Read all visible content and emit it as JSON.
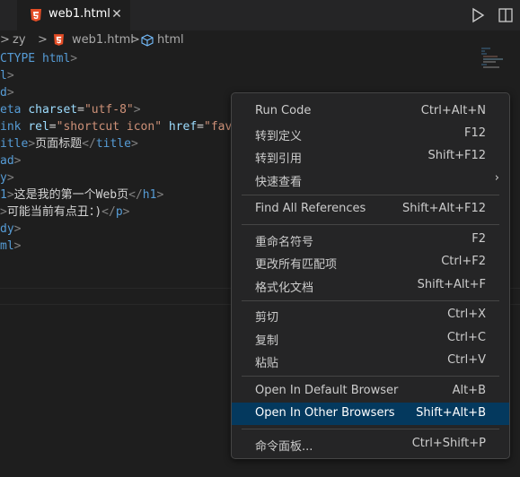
{
  "tab": {
    "label": "web1.html",
    "close": "✕"
  },
  "breadcrumb": {
    "chevron_start": ">",
    "folder": "zy",
    "sep": ">",
    "file": "web1.html",
    "sep2": ">",
    "symbol": "html"
  },
  "editor": {
    "l1": {
      "p1": "CTYPE ",
      "p2": "html",
      "p3": ">"
    },
    "l2": {
      "p1": "l",
      "p2": ">"
    },
    "l3": {
      "p1": "d",
      "p2": ">"
    },
    "l4": {
      "p1": "eta ",
      "p2": "charset",
      "p3": "=",
      "p4": "\"utf-8\"",
      "p5": ">"
    },
    "l5": {
      "p1": "ink ",
      "p2": "rel",
      "p3": "=",
      "p4": "\"shortcut icon\"",
      "p5": " ",
      "p6": "href",
      "p7": "=",
      "p8": "\"fav"
    },
    "l6": {
      "p1": "itle",
      "p2": ">",
      "p3": "页面标题",
      "p4": "</",
      "p5": "title",
      "p6": ">"
    },
    "l7": {
      "p1": "ad",
      "p2": ">"
    },
    "l8": {
      "p1": "y",
      "p2": ">"
    },
    "l9": {
      "p1": "1",
      "p2": ">",
      "p3": "这是我的第一个Web页",
      "p4": "</",
      "p5": "h1",
      "p6": ">"
    },
    "l10": {
      "p1": ">",
      "p2": "可能当前有点丑：)",
      "p3": "</",
      "p4": "p",
      "p5": ">"
    },
    "l11": {
      "p1": "dy",
      "p2": ">"
    },
    "l12": {
      "p1": "ml",
      "p2": ">"
    }
  },
  "menu": {
    "items": [
      {
        "label": "Run Code",
        "shortcut": "Ctrl+Alt+N"
      },
      {
        "label": "转到定义",
        "shortcut": "F12"
      },
      {
        "label": "转到引用",
        "shortcut": "Shift+F12"
      },
      {
        "label": "快速查看",
        "shortcut": ""
      },
      {
        "label": "Find All References",
        "shortcut": "Shift+Alt+F12"
      },
      {
        "label": "重命名符号",
        "shortcut": "F2"
      },
      {
        "label": "更改所有匹配项",
        "shortcut": "Ctrl+F2"
      },
      {
        "label": "格式化文档",
        "shortcut": "Shift+Alt+F"
      },
      {
        "label": "剪切",
        "shortcut": "Ctrl+X"
      },
      {
        "label": "复制",
        "shortcut": "Ctrl+C"
      },
      {
        "label": "粘贴",
        "shortcut": "Ctrl+V"
      },
      {
        "label": "Open In Default Browser",
        "shortcut": "Alt+B"
      },
      {
        "label": "Open In Other Browsers",
        "shortcut": "Shift+Alt+B"
      },
      {
        "label": "命令面板...",
        "shortcut": "Ctrl+Shift+P"
      }
    ],
    "submenu_arrow": "›"
  },
  "colors": {
    "highlight": "#04395e",
    "html_icon": "#e44d26",
    "tag": "#569cd6",
    "attr": "#9cdcfe",
    "string": "#ce9178",
    "bracket": "#808080"
  },
  "icons": {
    "tab": "html5-icon",
    "run": "play-icon",
    "split": "split-editor-icon",
    "symbol": "symbol-cube-icon"
  }
}
